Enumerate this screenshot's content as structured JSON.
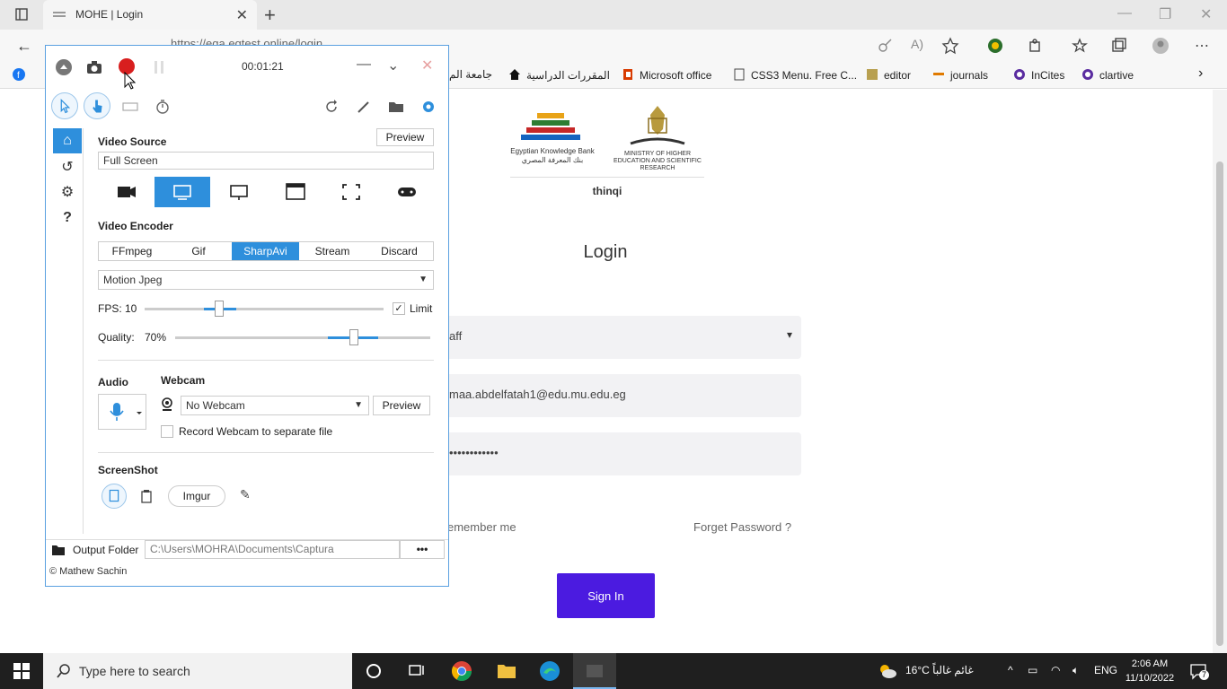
{
  "browser": {
    "tab_title": "MOHE | Login",
    "url": "https://eqa.eqtest.online/login",
    "bookmarks": [
      "جامعة الم",
      "المقررات الدراسية",
      "Microsoft office",
      "CSS3 Menu. Free C...",
      "editor",
      "journals",
      "InCites",
      "clartive"
    ]
  },
  "page": {
    "ekb_text": "Egyptian Knowledge Bank\nبنك المعرفة المصري",
    "mohe_text": "MINISTRY OF HIGHER EDUCATION AND SCIENTIFIC RESEARCH",
    "thinqi": "thinqi",
    "login_title": "Login",
    "role_value": "aff",
    "email_value": "maa.abdelfatah1@edu.mu.edu.eg",
    "password_value": "••••••••••••",
    "remember_label": "emember me",
    "forget_label": "Forget Password ?",
    "signin_label": "Sign In"
  },
  "captura": {
    "timer": "00:01:21",
    "video_source_label": "Video Source",
    "preview_label": "Preview",
    "source_value": "Full Screen",
    "video_encoder_label": "Video Encoder",
    "encoders": [
      "FFmpeg",
      "Gif",
      "SharpAvi",
      "Stream",
      "Discard"
    ],
    "codec_value": "Motion Jpeg",
    "fps_label": "FPS:",
    "fps_value": "10",
    "limit_label": "Limit",
    "quality_label": "Quality:",
    "quality_value": "70%",
    "fps_level": 10,
    "quality_level": 0.7,
    "audio_label": "Audio",
    "webcam_label": "Webcam",
    "webcam_value": "No Webcam",
    "webcam_preview_label": "Preview",
    "record_webcam_label": "Record Webcam to separate file",
    "screenshot_label": "ScreenShot",
    "imgur_label": "Imgur",
    "output_folder_label": "Output Folder",
    "output_path": "C:\\Users\\MOHRA\\Documents\\Captura",
    "more_label": "•••",
    "credit": "© Mathew Sachin"
  },
  "taskbar": {
    "search_placeholder": "Type here to search",
    "weather": "16°C  غائم غالباً",
    "language": "ENG",
    "time": "2:06 AM",
    "date": "11/10/2022",
    "notification_count": "7"
  },
  "colors": {
    "accent": "#2e8fdc",
    "signin": "#4b1be0",
    "record": "#d81e1e"
  }
}
